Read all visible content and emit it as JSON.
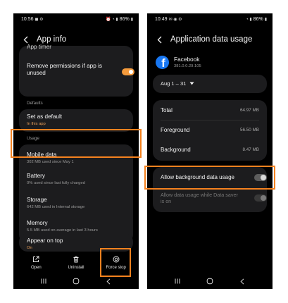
{
  "left": {
    "status": {
      "time": "10:56",
      "battery": "86%"
    },
    "title": "App info",
    "partial_item": "App timer",
    "remove_permissions": "Remove permissions if app is unused",
    "sections": {
      "defaults": "Defaults",
      "usage": "Usage"
    },
    "set_default": {
      "title": "Set as default",
      "sub": "In this app"
    },
    "mobile_data": {
      "title": "Mobile data",
      "sub": "302 MB used since May 1"
    },
    "battery": {
      "title": "Battery",
      "sub": "0% used since last fully charged"
    },
    "storage": {
      "title": "Storage",
      "sub": "642 MB used in Internal storage"
    },
    "memory": {
      "title": "Memory",
      "sub": "5.5 MB used on average in last 3 hours"
    },
    "appear_on_top": {
      "title": "Appear on top",
      "sub": "On"
    },
    "actions": {
      "open": "Open",
      "uninstall": "Uninstall",
      "force_stop": "Force stop"
    }
  },
  "right": {
    "status": {
      "time": "10:49",
      "battery": "86%"
    },
    "title": "Application data usage",
    "app": {
      "name": "Facebook",
      "version": "381.0.0.29.105"
    },
    "date_range": "Aug 1 – 31",
    "usage": {
      "total_label": "Total",
      "total_value": "64.97 MB",
      "foreground_label": "Foreground",
      "foreground_value": "56.50 MB",
      "background_label": "Background",
      "background_value": "8.47 MB"
    },
    "allow_background": "Allow background data usage",
    "allow_saver": "Allow data usage while Data saver is on"
  },
  "colors": {
    "accent": "#f5821f",
    "toggle_on": "#f59b3c",
    "card": "#1c1c1e",
    "facebook": "#1877f2"
  },
  "icons": [
    "back-icon",
    "open-icon",
    "uninstall-icon",
    "force-stop-icon",
    "facebook-icon",
    "dropdown-icon",
    "recents-icon",
    "home-icon",
    "nav-back-icon"
  ]
}
